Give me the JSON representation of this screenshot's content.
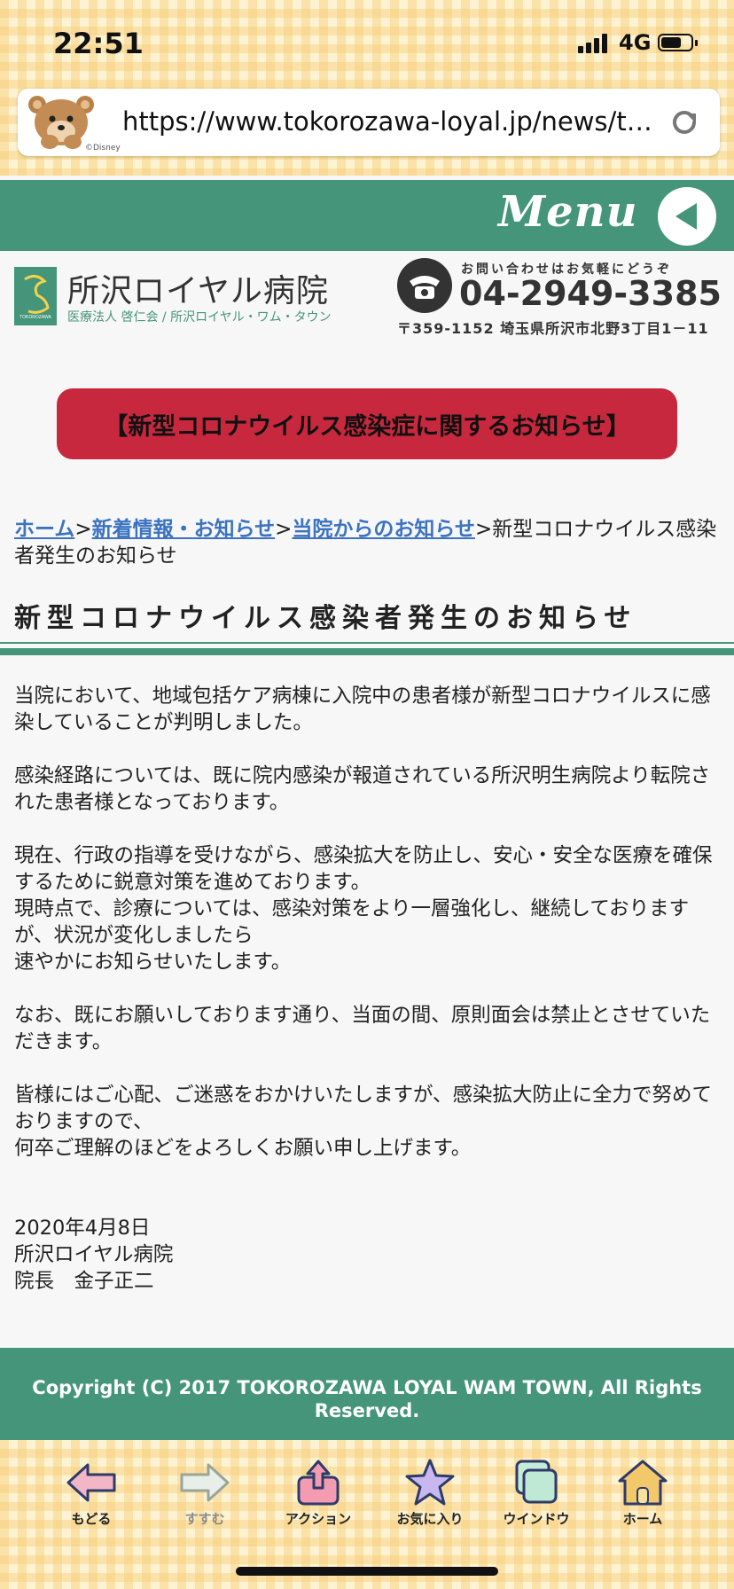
{
  "status_bar": {
    "time": "22:51",
    "network": "4G"
  },
  "browser": {
    "url": "https://www.tokorozawa-loyal.jp/news/tok...",
    "mascot_caption": "©Disney",
    "reload_icon": "reload-icon"
  },
  "menu": {
    "label": "Menu"
  },
  "header": {
    "hospital_name": "所沢ロイヤル病院",
    "hospital_sub": "医療法人 啓仁会 / 所沢ロイヤル・ワム・タウン",
    "contact_caption": "お問い合わせはお気軽にどうぞ",
    "phone": "04-2949-3385",
    "address": "〒359-1152 埼玉県所沢市北野3丁目1－11"
  },
  "banner": {
    "label": "【新型コロナウイルス感染症に関するお知らせ】"
  },
  "breadcrumb": {
    "home": "ホーム",
    "sep": ">",
    "news": "新着情報・お知らせ",
    "hospital_news": "当院からのお知らせ",
    "current": "新型コロナウイルス感染者発生のお知らせ"
  },
  "article": {
    "title": "新型コロナウイルス感染者発生のお知らせ",
    "p1": "当院において、地域包括ケア病棟に入院中の患者様が新型コロナウイルスに感染していることが判明しました。",
    "p2": "感染経路については、既に院内感染が報道されている所沢明生病院より転院された患者様となっております。",
    "p3a": "現在、行政の指導を受けながら、感染拡大を防止し、安心・安全な医療を確保するために鋭意対策を進めております。",
    "p3b": "現時点で、診療については、感染対策をより一層強化し、継続しておりますが、状況が変化しましたら",
    "p3c": "速やかにお知らせいたします。",
    "p4": "なお、既にお願いしております通り、当面の間、原則面会は禁止とさせていただきます。",
    "p5a": "皆様にはご心配、ご迷惑をおかけいたしますが、感染拡大防止に全力で努めておりますので、",
    "p5b": "何卒ご理解のほどをよろしくお願い申し上げます。",
    "date": "2020年4月8日",
    "org": "所沢ロイヤル病院",
    "signer": "院長　金子正二"
  },
  "footer": {
    "copyright": "Copyright (C) 2017 TOKOROZAWA LOYAL WAM TOWN, All Rights Reserved."
  },
  "toolbar": {
    "items": [
      {
        "label": "もどる",
        "icon": "back-arrow-icon"
      },
      {
        "label": "すすむ",
        "icon": "forward-arrow-icon"
      },
      {
        "label": "アクション",
        "icon": "share-icon"
      },
      {
        "label": "お気に入り",
        "icon": "star-icon"
      },
      {
        "label": "ウインドウ",
        "icon": "windows-icon"
      },
      {
        "label": "ホーム",
        "icon": "home-icon"
      }
    ]
  },
  "colors": {
    "brand_green": "#45957a",
    "banner_red": "#c8283e",
    "link_blue": "#3b73c2"
  }
}
